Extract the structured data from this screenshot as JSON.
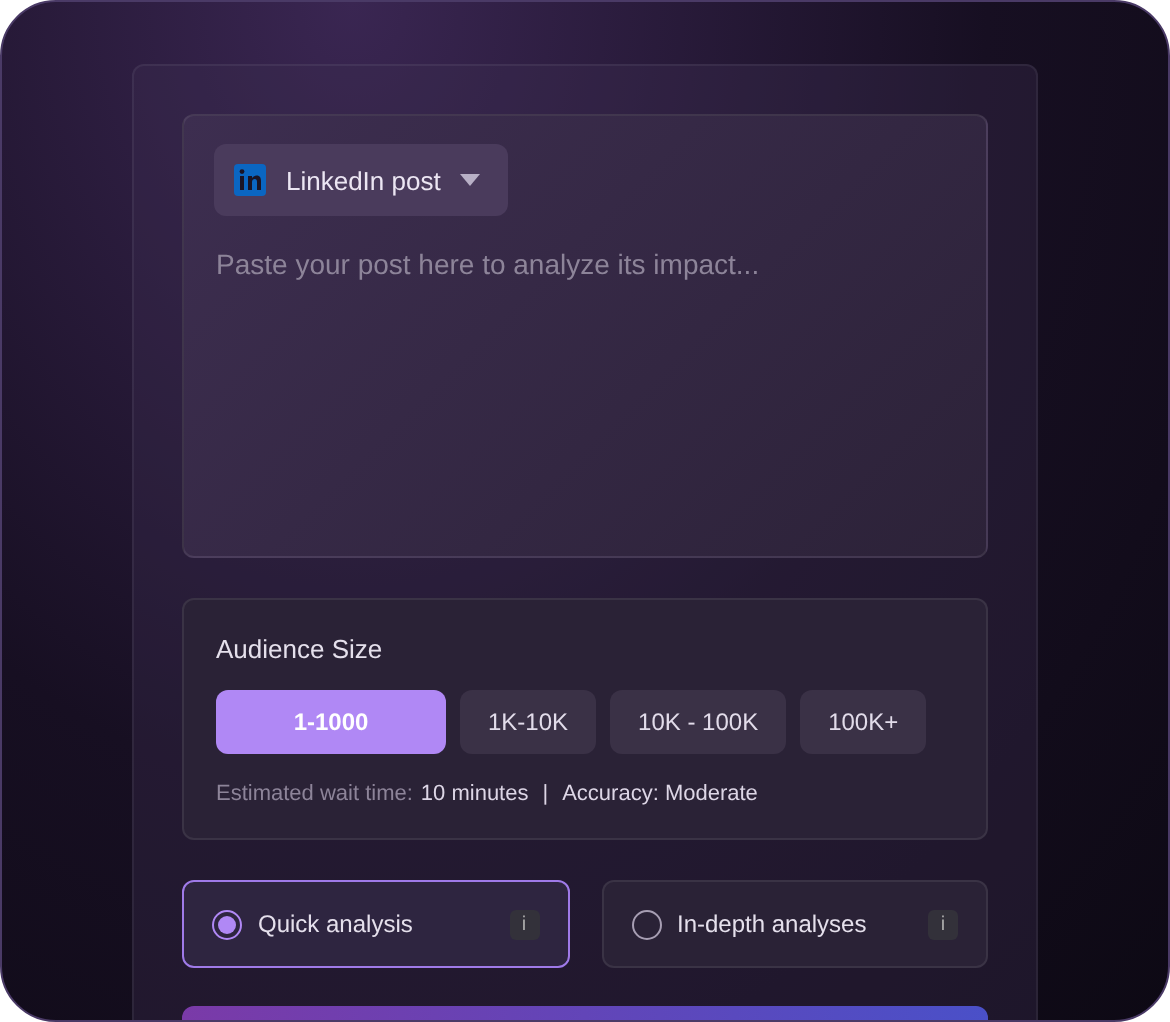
{
  "post": {
    "platform": {
      "label": "LinkedIn post"
    },
    "placeholder": "Paste your post here to analyze its impact..."
  },
  "audience": {
    "title": "Audience Size",
    "options": [
      {
        "label": "1-1000",
        "selected": true
      },
      {
        "label": "1K-10K",
        "selected": false
      },
      {
        "label": "10K - 100K",
        "selected": false
      },
      {
        "label": "100K+",
        "selected": false
      }
    ],
    "wait_label": "Estimated wait time:",
    "wait_value": "10 minutes",
    "separator": "|",
    "accuracy": "Accuracy: Moderate"
  },
  "analysis_modes": [
    {
      "label": "Quick analysis",
      "selected": true,
      "info": "i"
    },
    {
      "label": "In-depth analyses",
      "selected": false,
      "info": "i"
    }
  ]
}
